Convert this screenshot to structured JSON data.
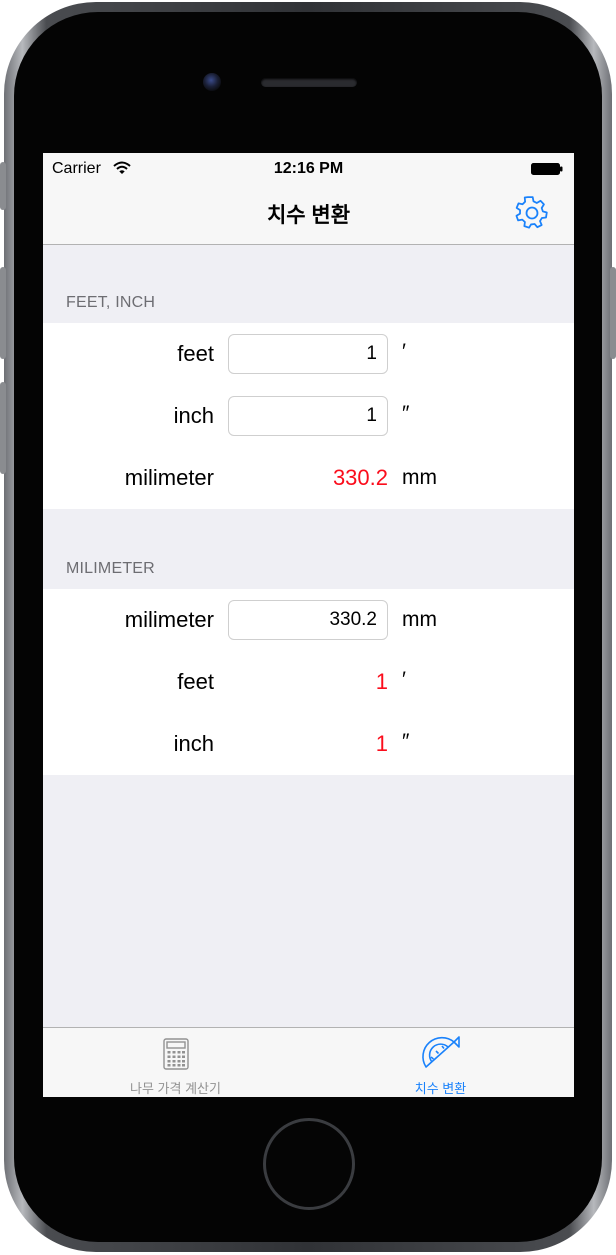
{
  "status": {
    "carrier": "Carrier",
    "time": "12:16 PM"
  },
  "nav": {
    "title": "치수 변환",
    "settings_icon": "gear-icon"
  },
  "sections": {
    "feet_inch": {
      "header": "FEET, INCH",
      "feet_label": "feet",
      "feet_value": "1",
      "feet_unit": "′",
      "inch_label": "inch",
      "inch_value": "1",
      "inch_unit": "″",
      "result_label": "milimeter",
      "result_value": "330.2",
      "result_unit": "mm"
    },
    "milimeter": {
      "header": "MILIMETER",
      "mm_label": "milimeter",
      "mm_value": "330.2",
      "mm_unit": "mm",
      "feet_label": "feet",
      "feet_value": "1",
      "feet_unit": "′",
      "inch_label": "inch",
      "inch_value": "1",
      "inch_unit": "″"
    }
  },
  "tabbar": {
    "tabs": [
      {
        "label": "나무 가격 계산기",
        "icon": "calculator-icon",
        "selected": false
      },
      {
        "label": "치수 변환",
        "icon": "protractor-icon",
        "selected": true
      }
    ]
  },
  "colors": {
    "accent": "#1a82fb",
    "result": "#fb0d1c",
    "inactive_tab": "#929292",
    "group_background": "#efeff4"
  }
}
